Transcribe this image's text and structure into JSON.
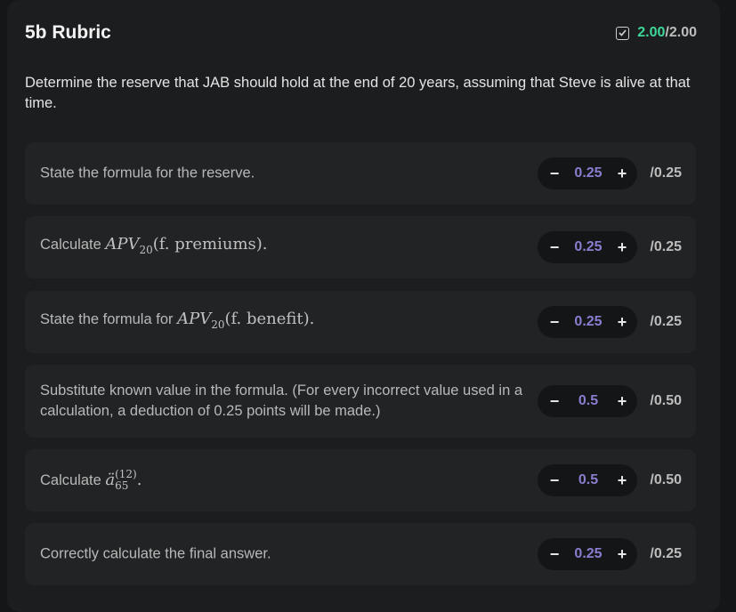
{
  "header": {
    "title": "5b Rubric",
    "score_earned": "2.00",
    "score_total": "/2.00",
    "score_color": "#3ed89a"
  },
  "question": "Determine the reserve that JAB should hold at the end of 20 years, assuming that Steve is alive at that time.",
  "items": [
    {
      "label": "State the formula for the reserve.",
      "value": "0.25",
      "max": "/0.25"
    },
    {
      "label_prefix": "Calculate ",
      "math_main": "APV",
      "math_sub": "20",
      "math_arg": "(f. premiums).",
      "value": "0.25",
      "max": "/0.25"
    },
    {
      "label_prefix": "State the formula for ",
      "math_main": "APV",
      "math_sub": "20",
      "math_arg": "(f. benefit).",
      "value": "0.25",
      "max": "/0.25"
    },
    {
      "label": "Substitute known value in the formula. (For every incorrect value used in a calculation, a deduction of 0.25 points will be made.)",
      "value": "0.5",
      "max": "/0.50"
    },
    {
      "label_prefix": "Calculate ",
      "math_main": "ä",
      "math_sup": "(12)",
      "math_sub": "65",
      "math_arg": ".",
      "value": "0.5",
      "max": "/0.50"
    },
    {
      "label": "Correctly calculate the final answer.",
      "value": "0.25",
      "max": "/0.25"
    }
  ],
  "stepper": {
    "minus": "−",
    "plus": "+"
  },
  "value_color": "#8a7dd0"
}
